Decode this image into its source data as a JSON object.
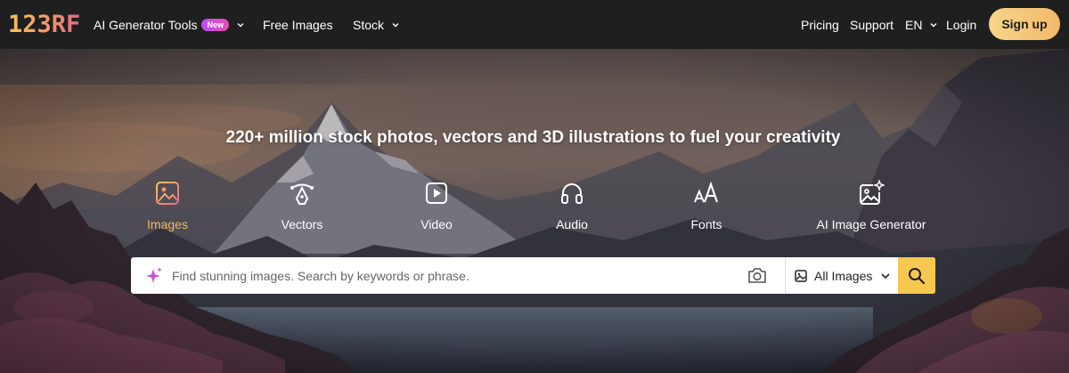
{
  "brand": {
    "logo_text": "123RF"
  },
  "nav": {
    "ai_tools": "AI Generator Tools",
    "ai_badge": "New",
    "free_images": "Free Images",
    "stock": "Stock",
    "pricing": "Pricing",
    "support": "Support",
    "language": "EN",
    "login": "Login",
    "signup": "Sign up"
  },
  "hero": {
    "headline": "220+ million stock photos, vectors and 3D illustrations to fuel your creativity"
  },
  "categories": [
    {
      "label": "Images",
      "icon": "image-icon",
      "active": true
    },
    {
      "label": "Vectors",
      "icon": "pen-tool-icon",
      "active": false
    },
    {
      "label": "Video",
      "icon": "play-icon",
      "active": false
    },
    {
      "label": "Audio",
      "icon": "headphones-icon",
      "active": false
    },
    {
      "label": "Fonts",
      "icon": "font-icon",
      "active": false
    },
    {
      "label": "AI Image Generator",
      "icon": "ai-image-icon",
      "active": false
    }
  ],
  "search": {
    "placeholder": "Find stunning images. Search by keywords or phrase.",
    "value": "",
    "type_selected": "All Images"
  },
  "colors": {
    "nav_bg": "#1f1f1f",
    "accent": "#f0b868",
    "signup_bg": "#f2c275",
    "search_button": "#f7c84f",
    "new_badge": "#d34fd0"
  }
}
